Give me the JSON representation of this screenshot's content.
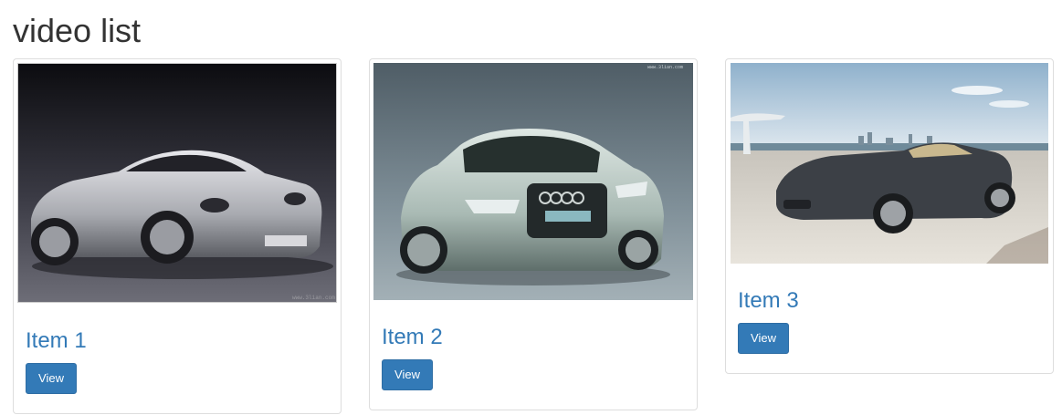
{
  "page": {
    "title": "video list"
  },
  "items": [
    {
      "title": "Item 1",
      "button_label": "View",
      "image_desc": "silver-convertible-sports-car",
      "watermark": "www.3lian.com"
    },
    {
      "title": "Item 2",
      "button_label": "View",
      "image_desc": "silver-concept-coupe",
      "watermark": "www.3lian.com"
    },
    {
      "title": "Item 3",
      "button_label": "View",
      "image_desc": "dark-grey-convertible-seaside"
    }
  ],
  "colors": {
    "link": "#337ab7",
    "button_bg": "#337ab7",
    "button_border": "#2e6da4",
    "card_border": "#dddddd",
    "title_text": "#333333"
  }
}
